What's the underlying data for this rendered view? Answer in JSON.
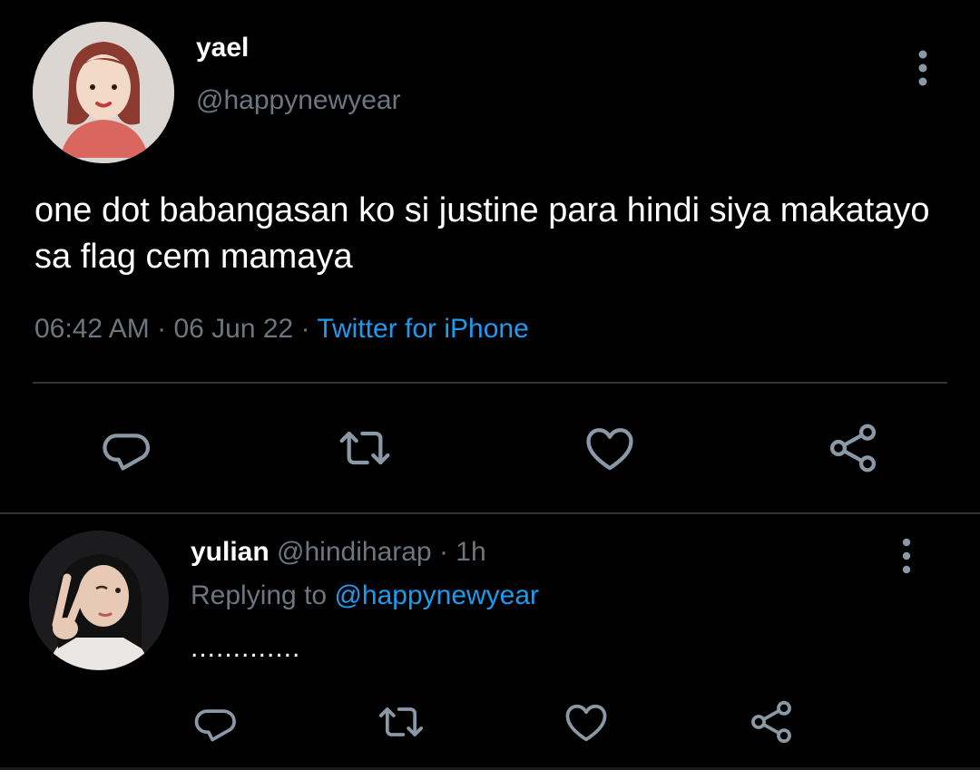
{
  "main_tweet": {
    "display_name": "yael",
    "handle": "@happynewyear",
    "text": "one dot babangasan ko si justine para hindi siya makatayo sa flag cem mamaya",
    "time": "06:42 AM",
    "sep1": " · ",
    "date": "06 Jun 22",
    "sep2": " · ",
    "source": "Twitter for iPhone",
    "actions": [
      "reply-icon",
      "retweet-icon",
      "like-icon",
      "share-icon"
    ]
  },
  "reply": {
    "display_name": "yulian",
    "handle": "@hindiharap",
    "sep": " · ",
    "age": "1h",
    "replying_prefix": "Replying to ",
    "replying_to": "@happynewyear",
    "text": ".............",
    "actions": [
      "reply-icon",
      "retweet-icon",
      "like-icon",
      "share-icon"
    ]
  },
  "colors": {
    "background": "#000000",
    "secondary_text": "#6e767d",
    "link": "#1d9bf0",
    "icon": "#8b98a5",
    "divider": "#2f3336"
  }
}
